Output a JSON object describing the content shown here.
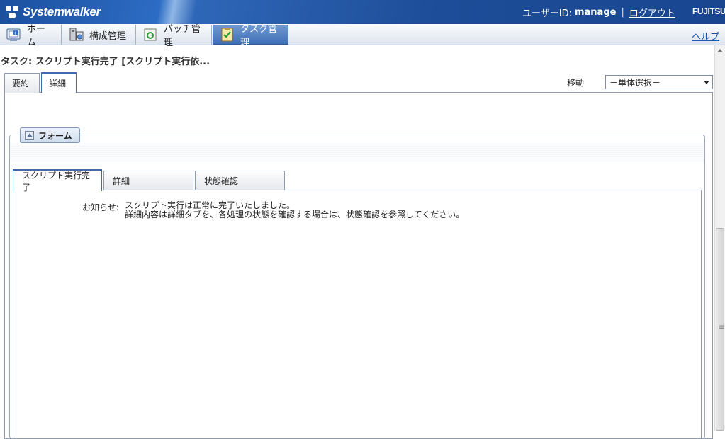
{
  "header": {
    "brand": "Systemwalker",
    "user_id_label": "ユーザーID:",
    "user_id": "manage",
    "separator": "|",
    "logout": "ログアウト",
    "vendor": "FUJITSU"
  },
  "nav": {
    "items": [
      {
        "label": "ホーム",
        "icon": "home-icon"
      },
      {
        "label": "構成管理",
        "icon": "configuration-icon"
      },
      {
        "label": "パッチ管理",
        "icon": "patch-icon"
      },
      {
        "label": "タスク管理",
        "icon": "task-icon",
        "active": true
      }
    ],
    "help": "ヘルプ"
  },
  "page": {
    "title": "タスク: スクリプト実行完了 [スクリプト実行依..."
  },
  "outer_tabs": [
    {
      "label": "要約"
    },
    {
      "label": "詳細",
      "active": true
    }
  ],
  "move": {
    "label": "移動",
    "selected": "－単体選択－"
  },
  "form": {
    "legend": "フォーム",
    "tabs": [
      {
        "label": "スクリプト実行完了",
        "active": true
      },
      {
        "label": "詳細"
      },
      {
        "label": "状態確認"
      }
    ],
    "notice_label": "お知らせ:",
    "notice_line1": "スクリプト実行は正常に完了いたしました。",
    "notice_line2": "詳細内容は詳細タブを、各処理の状態を確認する場合は、状態確認を参照してください。"
  },
  "colors": {
    "header_blue": "#1d4d98",
    "active_tab_blue": "#3f6ab0",
    "link_blue": "#1a55b0"
  }
}
